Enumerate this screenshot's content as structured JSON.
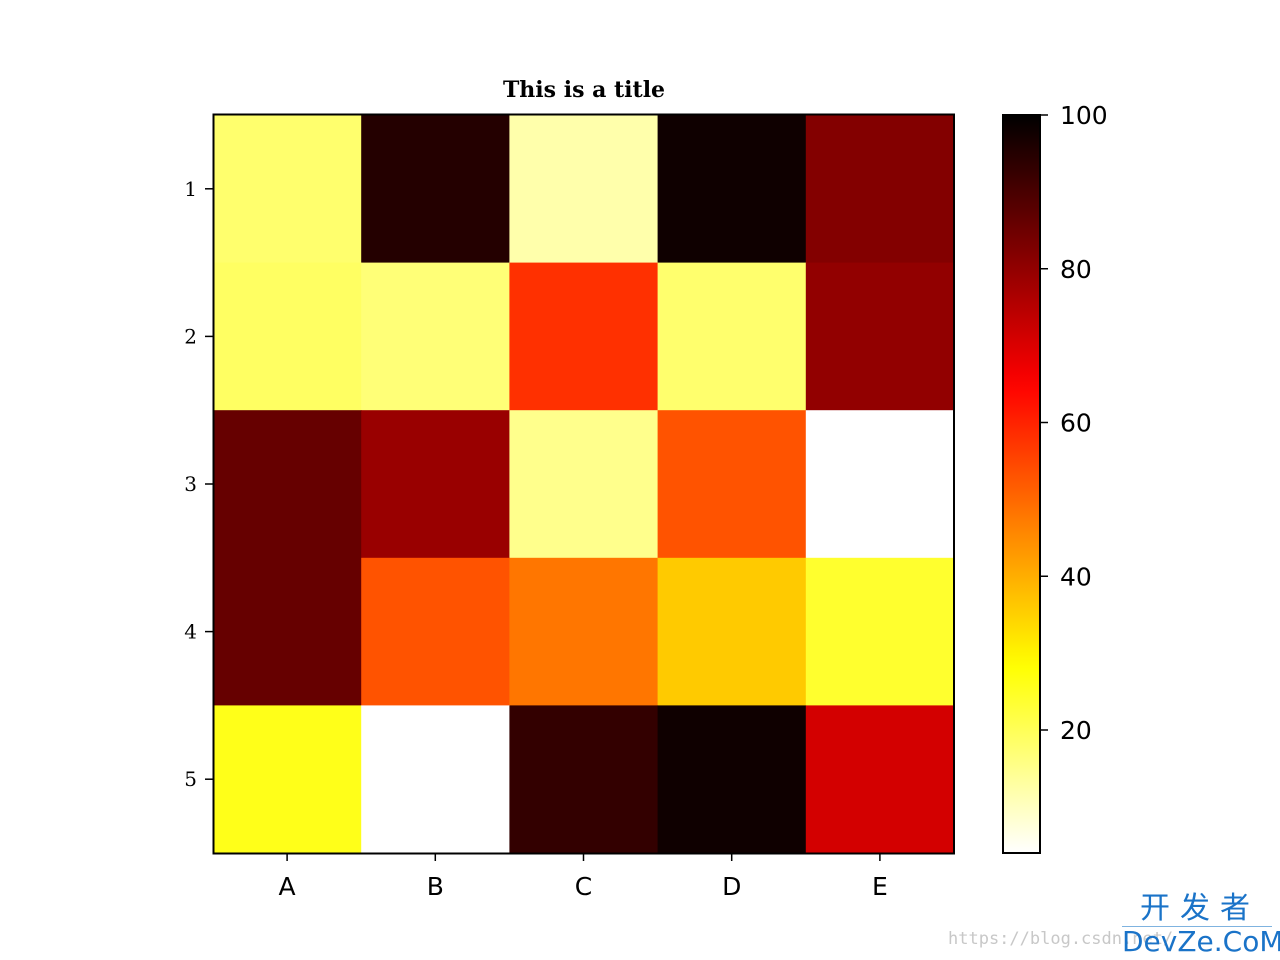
{
  "chart_data": {
    "type": "heatmap",
    "title": "This is a title",
    "xlabel": "",
    "ylabel": "",
    "x_categories": [
      "A",
      "B",
      "C",
      "D",
      "E"
    ],
    "y_categories": [
      "1",
      "2",
      "3",
      "4",
      "5"
    ],
    "values": [
      [
        18,
        95,
        12,
        98,
        82
      ],
      [
        19,
        17,
        58,
        18,
        80
      ],
      [
        86,
        79,
        15,
        53,
        4
      ],
      [
        86,
        53,
        48,
        36,
        24
      ],
      [
        26,
        4,
        93,
        98,
        71
      ]
    ],
    "colormap": "hot_r",
    "vmin": 4,
    "vmax": 100,
    "colorbar": {
      "ticks": [
        20,
        40,
        60,
        80,
        100
      ],
      "tick_labels": [
        "20",
        "40",
        "60",
        "80",
        "100"
      ],
      "placement": "right"
    },
    "grid": false
  },
  "watermark": {
    "url_text": "https://blog.csdn.net/",
    "logo_cn": "开发者",
    "logo_en": "DevZe.CoM",
    "color": "#1a73c8"
  }
}
